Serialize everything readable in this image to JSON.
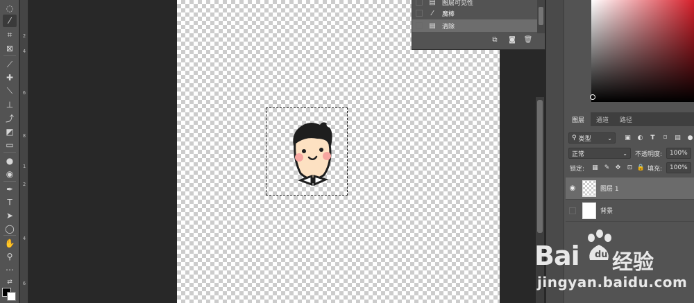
{
  "history": {
    "items": [
      {
        "label": "图层可见性",
        "icon": "document-icon",
        "selected": false
      },
      {
        "label": "魔棒",
        "icon": "magic-wand-icon",
        "selected": false
      },
      {
        "label": "清除",
        "icon": "document-icon",
        "selected": true
      }
    ],
    "footer_icons": [
      "new-snapshot-icon",
      "camera-icon",
      "trash-icon"
    ]
  },
  "layers_panel": {
    "tabs": [
      "图层",
      "通道",
      "路径"
    ],
    "active_tab": "图层",
    "filter": {
      "label": "类型"
    },
    "blend_mode": "正常",
    "opacity_label": "不透明度:",
    "opacity_value": "100%",
    "lock_label": "锁定:",
    "fill_label": "填充:",
    "fill_value": "100%",
    "layers": [
      {
        "name": "图层 1",
        "visible": true,
        "selected": true,
        "thumb": "transparent"
      },
      {
        "name": "背景",
        "visible": false,
        "selected": false,
        "thumb": "white"
      }
    ]
  },
  "ruler": {
    "labels": [
      "2",
      "4",
      "6",
      "8",
      "1",
      "2",
      "4",
      "6"
    ]
  },
  "colors": {
    "foreground": "#000000",
    "background": "#ffffff",
    "picker_hue": "#d6212c"
  },
  "watermark": {
    "brand_left": "Bai",
    "brand_right": "经验",
    "url": "jingyan.baidu.com"
  }
}
